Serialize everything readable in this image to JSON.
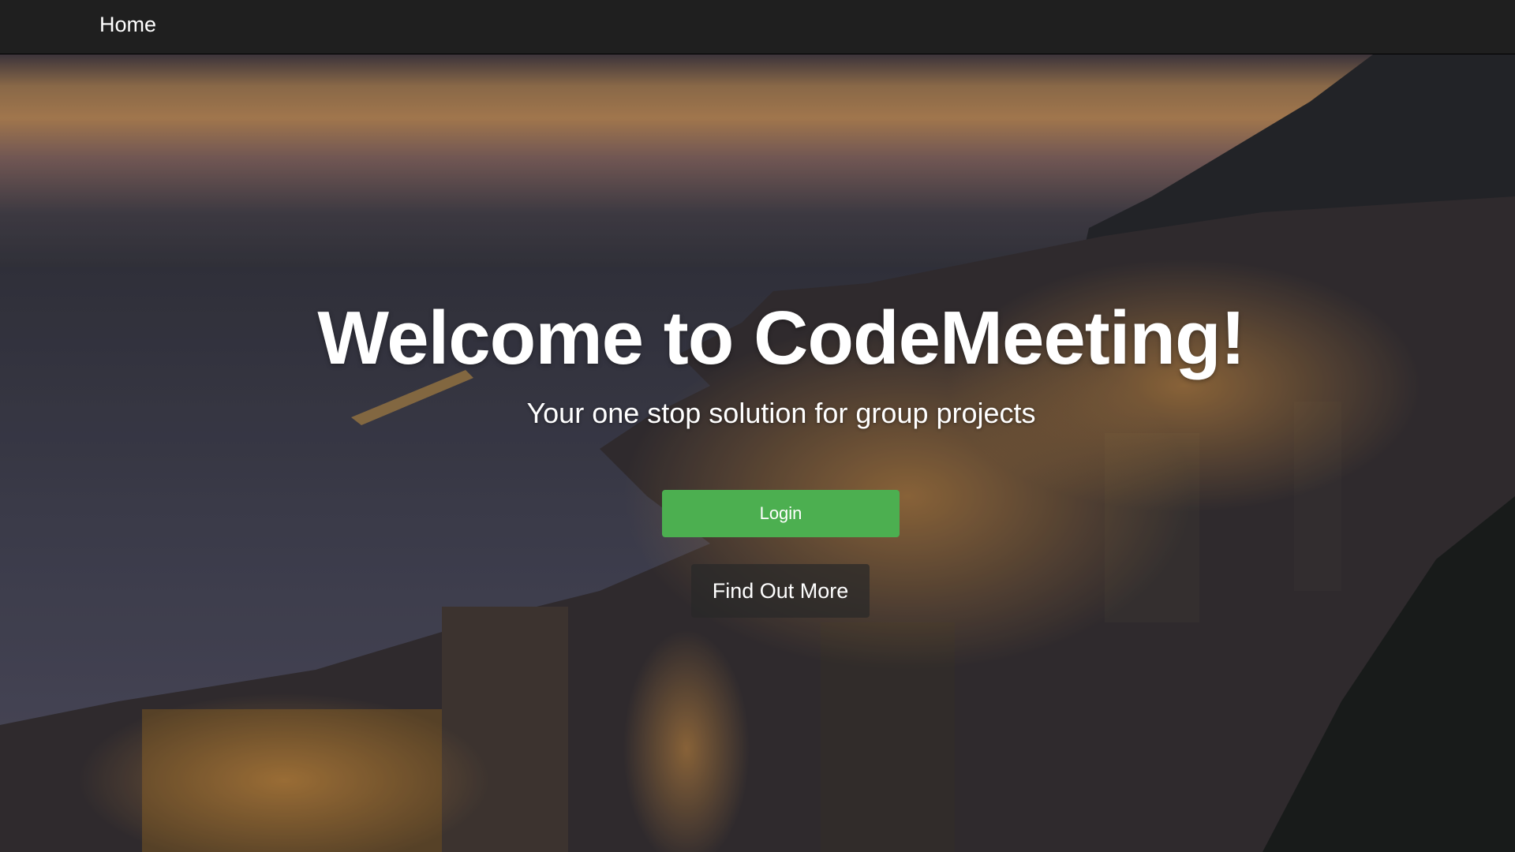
{
  "nav": {
    "home_label": "Home"
  },
  "hero": {
    "title": "Welcome to CodeMeeting!",
    "subtitle": "Your one stop solution for group projects",
    "login_label": "Login",
    "find_out_more_label": "Find Out More"
  },
  "colors": {
    "navbar": "#1f1f1f",
    "login_button": "#4caf50",
    "find_out_more_button": "#282828",
    "text": "#ffffff"
  }
}
